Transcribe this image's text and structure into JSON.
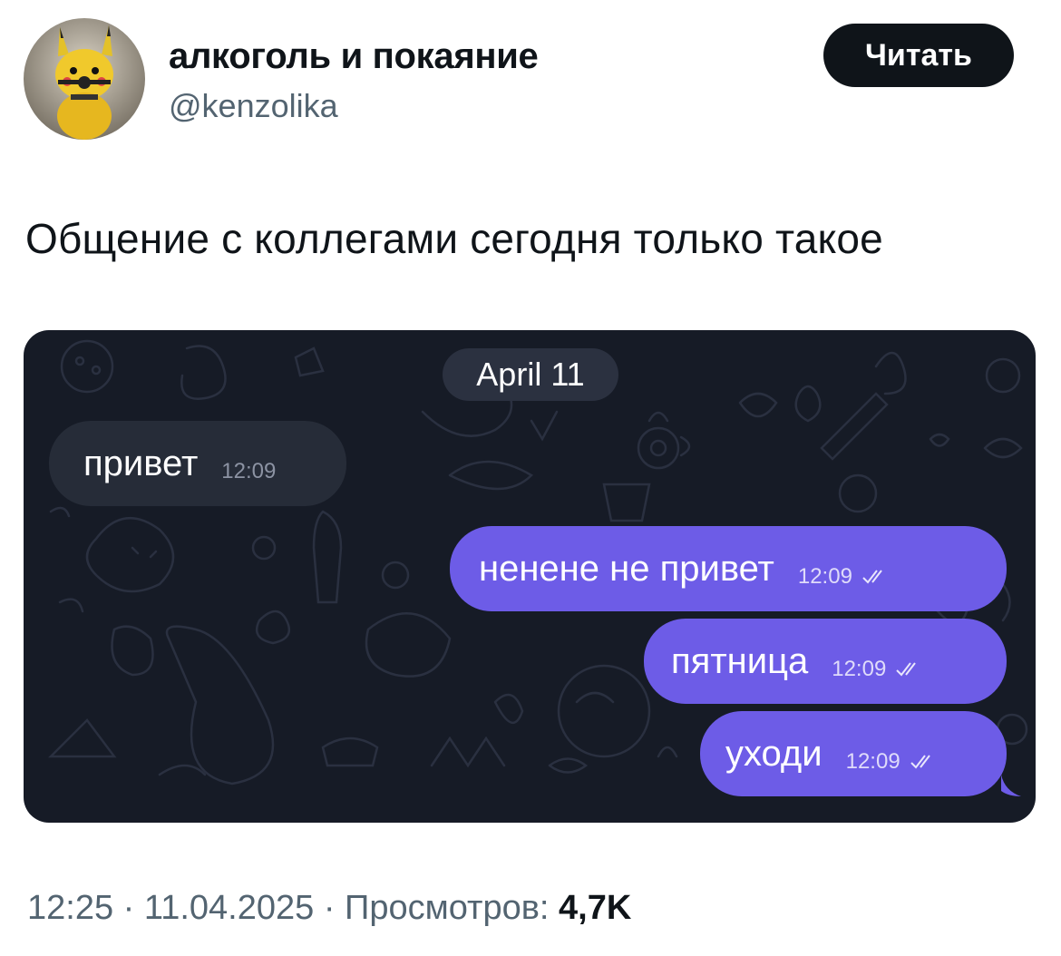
{
  "author": {
    "name": "алкоголь и покаяние",
    "handle": "@kenzolika"
  },
  "follow_button": {
    "label": "Читать"
  },
  "tweet": {
    "text": "Общение с коллегами сегодня только такое"
  },
  "chat": {
    "date": "April 11",
    "messages": [
      {
        "direction": "incoming",
        "text": "привет",
        "time": "12:09"
      },
      {
        "direction": "outgoing",
        "text": "ненене не привет",
        "time": "12:09",
        "status": "read"
      },
      {
        "direction": "outgoing",
        "text": "пятница",
        "time": "12:09",
        "status": "read"
      },
      {
        "direction": "outgoing",
        "text": "уходи",
        "time": "12:09",
        "status": "read"
      }
    ],
    "colors": {
      "background": "#161b26",
      "incoming": "#262c38",
      "outgoing": "#6d5ce7"
    }
  },
  "meta": {
    "time": "12:25",
    "separator": "·",
    "date": "11.04.2025",
    "views_label": "Просмотров:",
    "views_count": "4,7K"
  }
}
